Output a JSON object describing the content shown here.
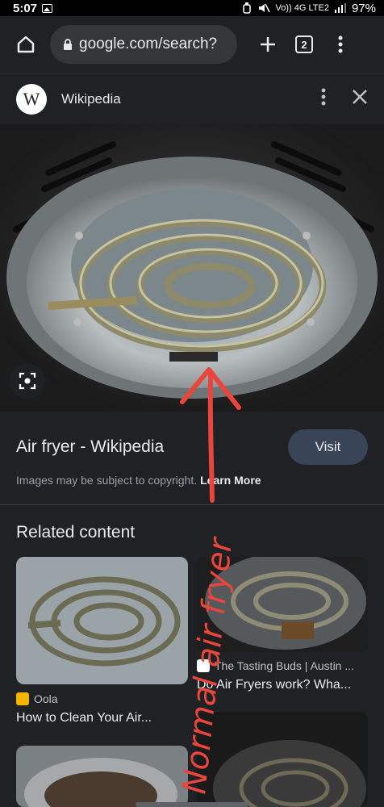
{
  "status_bar": {
    "time": "5:07",
    "network": "Vo)) 4G LTE2",
    "battery": "97%"
  },
  "browser": {
    "url": "google.com/search?",
    "tab_count": "2"
  },
  "panel": {
    "logo_letter": "W",
    "source": "Wikipedia",
    "title": "Air fryer - Wikipedia",
    "visit_label": "Visit",
    "copyright": "Images may be subject to copyright.",
    "learn_more": "Learn More"
  },
  "related": {
    "heading": "Related content",
    "cards": [
      {
        "source": "Oola",
        "title": "How to Clean Your Air...",
        "favicon_color": "#f4b400"
      },
      {
        "source": "The Tasting Buds | Austin ...",
        "title": "Do Air Fryers work? Wha...",
        "favicon_color": "#ffffff"
      }
    ]
  },
  "annotation": {
    "text": "Normal air fryer",
    "color": "#e8453c"
  },
  "icons": [
    "home-icon",
    "lock-icon",
    "plus-icon",
    "tab-switcher-icon",
    "more-vert-icon",
    "close-icon",
    "lens-icon",
    "pencil-icon"
  ]
}
